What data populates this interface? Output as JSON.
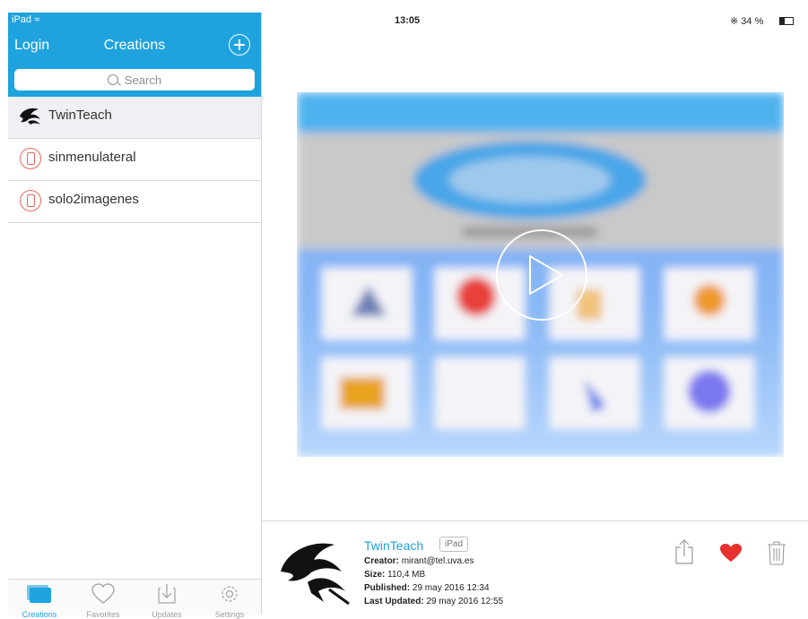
{
  "status_bar": {
    "device": "iPad",
    "time": "13:05",
    "battery_text": "34 %",
    "battery_level": 0.34
  },
  "sidebar": {
    "login_label": "Login",
    "title": "Creations",
    "search_placeholder": "Search",
    "items": [
      {
        "label": "TwinTeach",
        "icon": "dolphin-logo",
        "selected": true
      },
      {
        "label": "sinmenulateral",
        "icon": "device-icon",
        "selected": false
      },
      {
        "label": "solo2imagenes",
        "icon": "device-icon",
        "selected": false
      }
    ],
    "tabs": [
      {
        "label": "Creations",
        "icon": "creations-icon",
        "active": true
      },
      {
        "label": "Favorites",
        "icon": "heart-icon",
        "active": false
      },
      {
        "label": "Updates",
        "icon": "download-icon",
        "active": false
      },
      {
        "label": "Settings",
        "icon": "gear-icon",
        "active": false
      }
    ]
  },
  "detail": {
    "name": "TwinTeach",
    "platform": "iPad",
    "creator_label": "Creator:",
    "creator": "mirant@tel.uva.es",
    "size_label": "Size:",
    "size": "110,4 MB",
    "published_label": "Published:",
    "published": "29 may 2016 12:34",
    "updated_label": "Last Updated:",
    "updated": "29 may 2016 12:55",
    "actions": [
      "share-icon",
      "heart-icon",
      "trash-icon"
    ]
  },
  "colors": {
    "accent": "#1fa3de",
    "heart": "#e8312f",
    "device_icon": "#e8665e"
  }
}
